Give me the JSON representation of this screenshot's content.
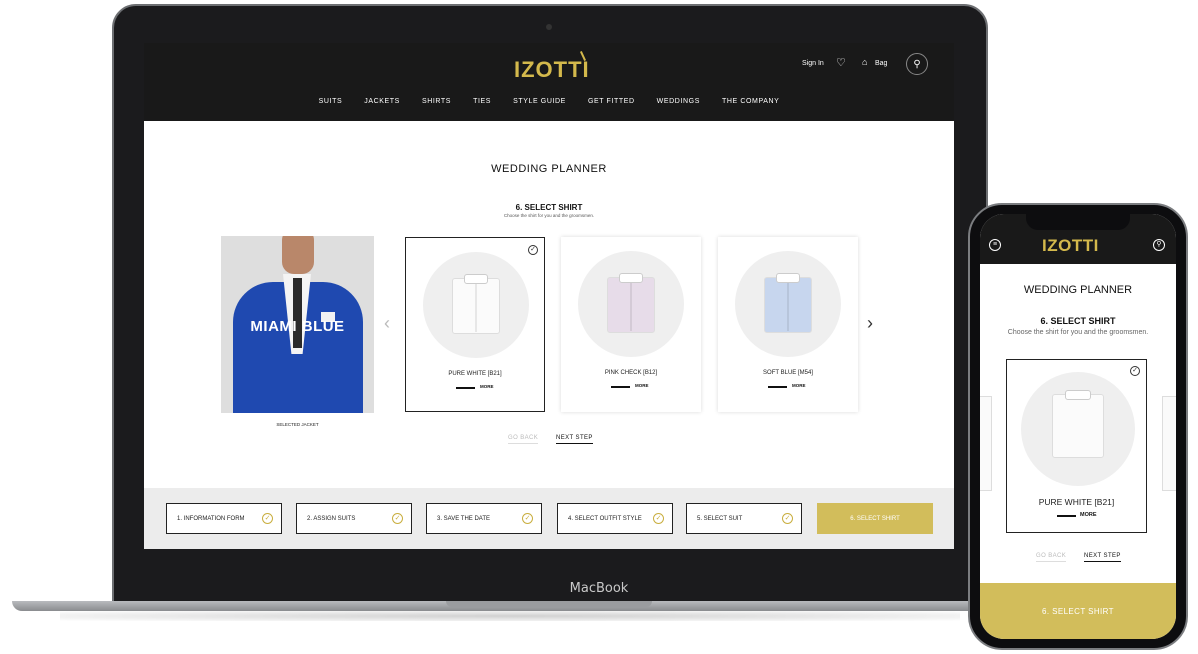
{
  "laptop": {
    "brand_label": "MacBook"
  },
  "desktop": {
    "header": {
      "logo": "IZOTTI",
      "sign_in": "Sign In",
      "bag": "Bag",
      "nav": [
        "SUITS",
        "JACKETS",
        "SHIRTS",
        "TIES",
        "STYLE GUIDE",
        "GET FITTED",
        "WEDDINGS",
        "THE COMPANY"
      ]
    },
    "page_title": "WEDDING PLANNER",
    "step_title": "6. SELECT SHIRT",
    "step_subtitle": "Choose the shirt for you and the groomsmen.",
    "jacket": {
      "name": "MIAMI BLUE",
      "caption": "SELECTED JACKET",
      "color": "#1f49b0"
    },
    "shirts": [
      {
        "name": "PURE WHITE [B21]",
        "more": "MORE",
        "color": "#fbfbfb",
        "selected": true
      },
      {
        "name": "PINK CHECK [B12]",
        "more": "MORE",
        "color": "#e7dce9",
        "selected": false
      },
      {
        "name": "SOFT BLUE [M54]",
        "more": "MORE",
        "color": "#c7d6ee",
        "selected": false
      }
    ],
    "go_back": "GO BACK",
    "next_step": "NEXT STEP",
    "steps": [
      {
        "label": "1. INFORMATION FORM",
        "done": true
      },
      {
        "label": "2. ASSIGN SUITS",
        "done": true
      },
      {
        "label": "3. SAVE THE DATE",
        "done": true
      },
      {
        "label": "4. SELECT OUTFIT STYLE",
        "done": true
      },
      {
        "label": "5. SELECT SUIT",
        "done": true
      },
      {
        "label": "6. SELECT SHIRT",
        "done": false,
        "active": true
      }
    ],
    "accent_color": "#d2bd5b"
  },
  "mobile": {
    "logo": "IZOTTI",
    "page_title": "WEDDING PLANNER",
    "step_title": "6. SELECT SHIRT",
    "step_subtitle": "Choose the shirt for you and the groomsmen.",
    "shirt": {
      "name": "PURE WHITE [B21]",
      "more": "MORE"
    },
    "go_back": "GO BACK",
    "next_step": "NEXT STEP",
    "bottom_button": "6. SELECT SHIRT"
  }
}
